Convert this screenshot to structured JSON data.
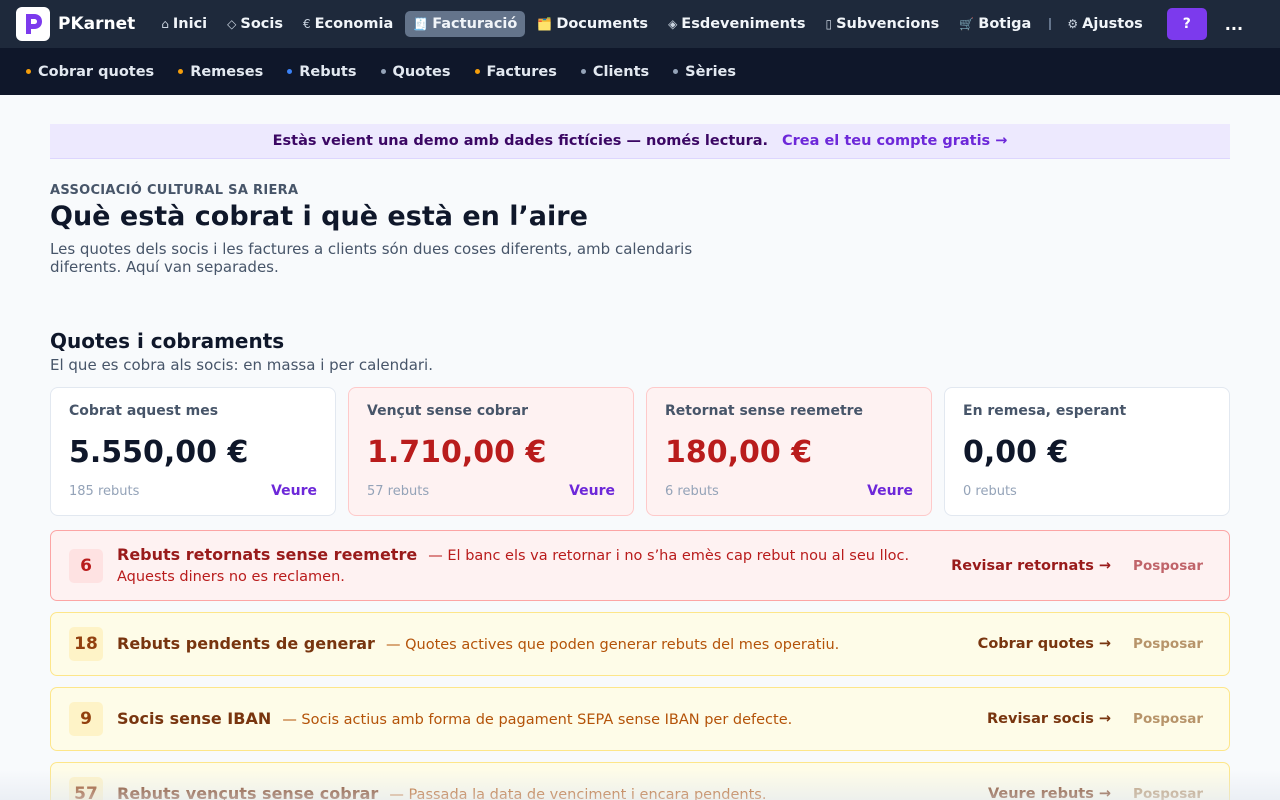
{
  "app": {
    "name": "PKarnet",
    "logo_letter": "P"
  },
  "topnav": {
    "items": [
      {
        "label": "Inici",
        "icon": "⌂"
      },
      {
        "label": "Socis",
        "icon": "◇"
      },
      {
        "label": "Economia",
        "icon": "€"
      },
      {
        "label": "Facturació",
        "icon": "🧾"
      },
      {
        "label": "Documents",
        "icon": "🗂️"
      },
      {
        "label": "Esdeveniments",
        "icon": "◈"
      },
      {
        "label": "Subvencions",
        "icon": "▯"
      },
      {
        "label": "Botiga",
        "icon": "🛒"
      }
    ],
    "settings_label": "Ajustos",
    "settings_icon": "⚙",
    "help_label": "?",
    "more_label": "..."
  },
  "subnav": {
    "items": [
      {
        "label": "Cobrar quotes",
        "dot_color": "#f59e0b"
      },
      {
        "label": "Remeses",
        "dot_color": "#f59e0b"
      },
      {
        "label": "Rebuts",
        "dot_color": "#3b82f6"
      },
      {
        "label": "Quotes",
        "dot_color": "#94a3b8"
      },
      {
        "label": "Factures",
        "dot_color": "#f59e0b"
      },
      {
        "label": "Clients",
        "dot_color": "#94a3b8"
      },
      {
        "label": "Sèries",
        "dot_color": "#94a3b8"
      }
    ]
  },
  "banner": {
    "text": "Estàs veient una demo amb dades fictícies — només lectura.",
    "link": "Crea el teu compte gratis →"
  },
  "header": {
    "org": "ASSOCIACIÓ CULTURAL SA RIERA",
    "title": "Què està cobrat i què està en l’aire",
    "subtitle": "Les quotes dels socis i les factures a clients són dues coses diferents, amb calendaris diferents. Aquí van separades."
  },
  "section": {
    "title": "Quotes i cobraments",
    "subtitle": "El que es cobra als socis: en massa i per calendari."
  },
  "cards": [
    {
      "label": "Cobrat aquest mes",
      "value": "5.550,00 €",
      "count": "185 rebuts",
      "link": "Veure"
    },
    {
      "label": "Vençut sense cobrar",
      "value": "1.710,00 €",
      "count": "57 rebuts",
      "link": "Veure"
    },
    {
      "label": "Retornat sense reemetre",
      "value": "180,00 €",
      "count": "6 rebuts",
      "link": "Veure"
    },
    {
      "label": "En remesa, esperant",
      "value": "0,00 €",
      "count": "0 rebuts",
      "link": ""
    }
  ],
  "alerts": [
    {
      "count": "6",
      "title": "Rebuts retornats sense reemetre",
      "desc": "— El banc els va retornar i no s’ha emès cap rebut nou al seu lloc. Aquests diners no es reclamen.",
      "action": "Revisar retornats →",
      "postpone": "Posposar"
    },
    {
      "count": "18",
      "title": "Rebuts pendents de generar",
      "desc": "— Quotes actives que poden generar rebuts del mes operatiu.",
      "action": "Cobrar quotes →",
      "postpone": "Posposar"
    },
    {
      "count": "9",
      "title": "Socis sense IBAN",
      "desc": "— Socis actius amb forma de pagament SEPA sense IBAN per defecte.",
      "action": "Revisar socis →",
      "postpone": "Posposar"
    },
    {
      "count": "57",
      "title": "Rebuts vençuts sense cobrar",
      "desc": "— Passada la data de venciment i encara pendents.",
      "action": "Veure rebuts →",
      "postpone": "Posposar"
    }
  ],
  "colors": {
    "accent": "#7c3aed",
    "topnav_bg": "#1e293b",
    "subnav_bg": "#0f172a",
    "danger": "#b91c1c",
    "warning": "#78350f"
  }
}
